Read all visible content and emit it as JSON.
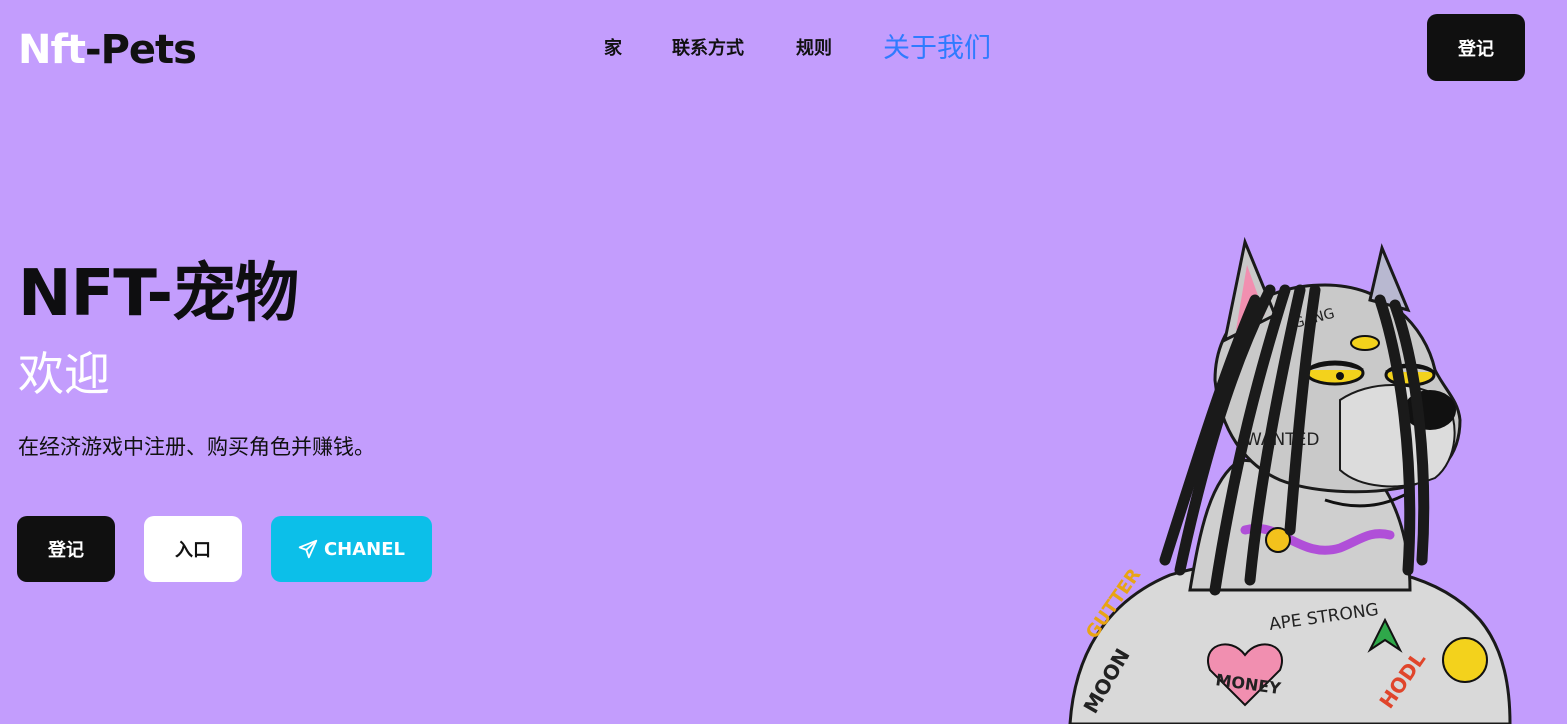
{
  "header": {
    "logo_part1": "Nft",
    "logo_part2": "-Pets",
    "nav": [
      {
        "label": "家"
      },
      {
        "label": "联系方式"
      },
      {
        "label": "规则"
      },
      {
        "label": "关于我们"
      }
    ],
    "register_label": "登记"
  },
  "hero": {
    "title": "NFT-宠物",
    "subtitle": "欢迎",
    "description": "在经济游戏中注册、购买角色并赚钱。",
    "buttons": {
      "register": "登记",
      "enter": "入口",
      "channel": "CHANEL"
    },
    "art_text": {
      "gang": "GANG",
      "wanted": "WANTED",
      "ape_strong": "APE STRONG",
      "money": "MONEY",
      "hodl": "HODL",
      "gutter": "GUTTER",
      "moon": "MOON"
    }
  },
  "colors": {
    "background": "#c39dfd",
    "dark_button": "#101010",
    "accent_blue": "#2f7bff",
    "channel_button": "#0cbfe9"
  },
  "icons": {
    "channel": "paper-plane-icon"
  }
}
